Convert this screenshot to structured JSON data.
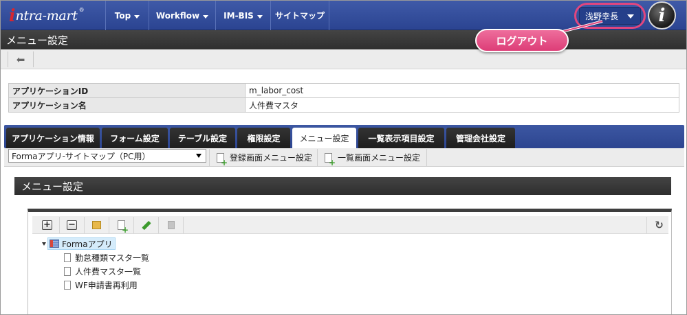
{
  "app": {
    "logo_mark": "i",
    "logo_text": "ntra-mart",
    "logo_reg": "®"
  },
  "nav": {
    "items": [
      {
        "label": "Top",
        "has_dropdown": true
      },
      {
        "label": "Workflow",
        "has_dropdown": true
      },
      {
        "label": "IM-BIS",
        "has_dropdown": true
      },
      {
        "label": "サイトマップ",
        "has_dropdown": false
      }
    ],
    "user_name": "浅野幸長",
    "info_badge": "i"
  },
  "page": {
    "title": "メニュー設定"
  },
  "callout": {
    "label": "ログアウト",
    "color": "#e2467e"
  },
  "app_info": {
    "rows": [
      {
        "label": "アプリケーションID",
        "value": "m_labor_cost"
      },
      {
        "label": "アプリケーション名",
        "value": "人件費マスタ"
      }
    ]
  },
  "tabs": [
    {
      "label": "アプリケーション情報",
      "active": false
    },
    {
      "label": "フォーム設定",
      "active": false
    },
    {
      "label": "テーブル設定",
      "active": false
    },
    {
      "label": "権限設定",
      "active": false
    },
    {
      "label": "メニュー設定",
      "active": true
    },
    {
      "label": "一覧表示項目設定",
      "active": false
    },
    {
      "label": "管理会社設定",
      "active": false
    }
  ],
  "subtoolbar": {
    "select_value": "Formaアプリ-サイトマップ（PC用）",
    "buttons": [
      {
        "label": "登録画面メニュー設定",
        "icon": "add-document-icon"
      },
      {
        "label": "一覧画面メニュー設定",
        "icon": "add-document-icon"
      }
    ]
  },
  "menu_section": {
    "title": "メニュー設定"
  },
  "tree": {
    "tools": [
      "expand-all-icon",
      "collapse-all-icon",
      "add-folder-icon",
      "add-page-icon",
      "edit-icon",
      "delete-icon"
    ],
    "refresh_icon": "refresh-icon",
    "root": {
      "label": "Formaアプリ",
      "icon": "app-grid-icon",
      "expanded": true
    },
    "children": [
      {
        "label": "勤怠種類マスタ一覧"
      },
      {
        "label": "人件費マスタ一覧"
      },
      {
        "label": "WF申請書再利用"
      }
    ]
  },
  "colors": {
    "nav_blue": "#2f4896",
    "title_dark": "#333333",
    "accent_pink": "#e2467e"
  }
}
